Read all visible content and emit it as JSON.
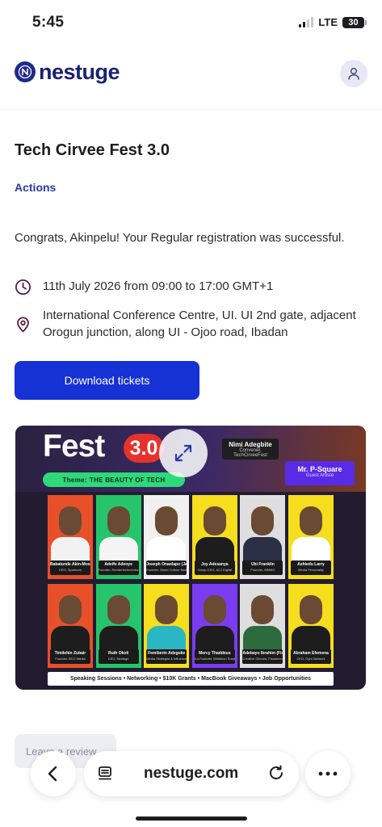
{
  "status_bar": {
    "time": "5:45",
    "network": "LTE",
    "battery": "30"
  },
  "header": {
    "logo_text": "nestuge",
    "logo_letter": "N"
  },
  "event": {
    "title": "Tech Cirvee Fest 3.0",
    "actions_label": "Actions",
    "congrats_message": "Congrats, Akinpelu! Your Regular registration was successful.",
    "date_time": "11th July 2026 from 09:00 to 17:00 GMT+1",
    "venue": "International Conference Centre, UI. UI 2nd gate, adjacent Orogun junction, along UI - Ojoo road, Ibadan",
    "download_label": "Download tickets",
    "review_label": "Leave a review"
  },
  "banner": {
    "title": "Fest",
    "edition": "3.0",
    "theme_prefix": "Theme:",
    "theme": "THE BEAUTY OF TECH",
    "convener": {
      "name": "Nimi Adegbite",
      "role": "Convener, TechCirveeFest"
    },
    "guest": {
      "name": "Mr. P-Square",
      "role": "Guest Artiste"
    },
    "tagline": "Speaking Sessions  •  Networking  •  $10K Grants  •  MacBook Giveaways  •  Job Opportunities",
    "speakers": [
      {
        "name": "Babatunde Akin-Moses",
        "role": "CEO, Spurtcom",
        "bg": "#e8502a",
        "outfit": "#f2f2f2"
      },
      {
        "name": "Adeife Adeoye",
        "role": "Founder, Rendertechmentor",
        "bg": "#26c46b",
        "outfit": "#f4f4f4"
      },
      {
        "name": "Joseph Onaolapo (Jay On Air)",
        "role": "Founder, World Culture Nation",
        "bg": "#f0f0f0",
        "outfit": "#ffffff"
      },
      {
        "name": "Joy Adesanya",
        "role": "Group CEO, ACJ Digital",
        "bg": "#f6dd1e",
        "outfit": "#1d1d1d"
      },
      {
        "name": "Ubi Franklin",
        "role": "Founder, MMMG",
        "bg": "#dedede",
        "outfit": "#2a2f45"
      },
      {
        "name": "Ashiedu Larry",
        "role": "Media Personality",
        "bg": "#f6dd1e",
        "outfit": "#ffffff"
      },
      {
        "name": "Timilehin Zubair",
        "role": "Founder, BCC Media",
        "bg": "#e8502a",
        "outfit": "#1d1d1d"
      },
      {
        "name": "Ruth Okoli",
        "role": "CEO, Nestuge",
        "bg": "#26c46b",
        "outfit": "#1d1d1d"
      },
      {
        "name": "Femiberin Adegoke",
        "role": "Media Strategist & Influencer",
        "bg": "#f6dd1e",
        "outfit": "#2bb6c4"
      },
      {
        "name": "Mercy Thaddeus",
        "role": "Co-Founder, Whitelion Society",
        "bg": "#7b3cf0",
        "outfit": "#1d1d1d"
      },
      {
        "name": "Adebayo Ibrahim (Fissbemo)",
        "role": "Creative Director, Fissbemo TV",
        "bg": "#dedede",
        "outfit": "#2e6b3c"
      },
      {
        "name": "Abraham Efemena",
        "role": "CEO, Gyro Network",
        "bg": "#f6dd1e",
        "outfit": "#1d1d1d"
      }
    ]
  },
  "browser": {
    "url": "nestuge.com"
  },
  "colors": {
    "primary": "#1631d4",
    "brand": "#1a2174",
    "link": "#2a3aa8"
  }
}
